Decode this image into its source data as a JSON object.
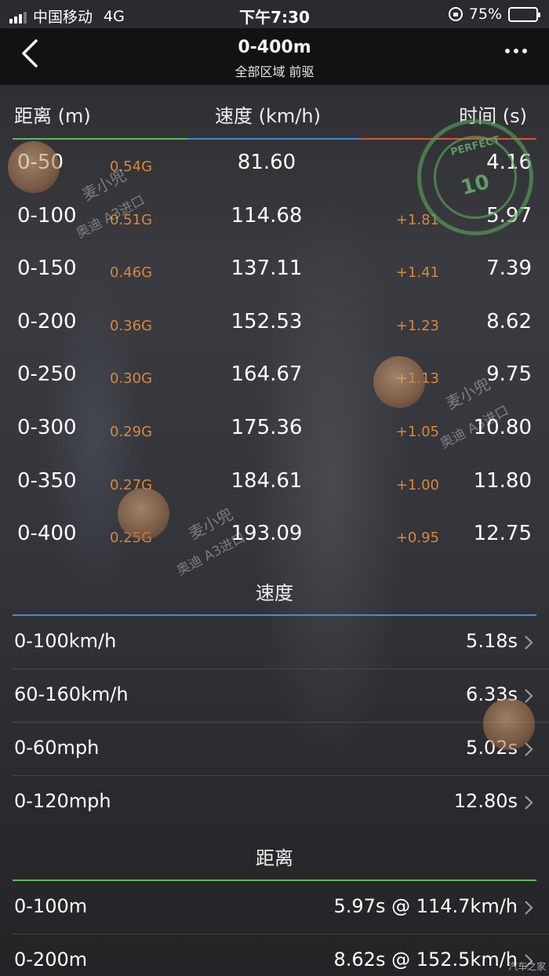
{
  "status_bar": {
    "carrier": "中国移动",
    "network": "4G",
    "time": "下午7:30",
    "battery_percent": "75%",
    "battery_level": 0.75
  },
  "nav": {
    "title": "0-400m",
    "subtitle": "全部区域 前驱"
  },
  "columns": {
    "distance": "距离 (m)",
    "speed": "速度 (km/h)",
    "time": "时间 (s)"
  },
  "rows": [
    {
      "dist": "0-50",
      "g": "0.54G",
      "speed": "81.60",
      "delta": "",
      "time": "4.16"
    },
    {
      "dist": "0-100",
      "g": "0.51G",
      "speed": "114.68",
      "delta": "+1.81",
      "time": "5.97"
    },
    {
      "dist": "0-150",
      "g": "0.46G",
      "speed": "137.11",
      "delta": "+1.41",
      "time": "7.39"
    },
    {
      "dist": "0-200",
      "g": "0.36G",
      "speed": "152.53",
      "delta": "+1.23",
      "time": "8.62"
    },
    {
      "dist": "0-250",
      "g": "0.30G",
      "speed": "164.67",
      "delta": "+1.13",
      "time": "9.75"
    },
    {
      "dist": "0-300",
      "g": "0.29G",
      "speed": "175.36",
      "delta": "+1.05",
      "time": "10.80"
    },
    {
      "dist": "0-350",
      "g": "0.27G",
      "speed": "184.61",
      "delta": "+1.00",
      "time": "11.80"
    },
    {
      "dist": "0-400",
      "g": "0.25G",
      "speed": "193.09",
      "delta": "+0.95",
      "time": "12.75"
    }
  ],
  "speed_section": {
    "title": "速度",
    "items": [
      {
        "label": "0-100km/h",
        "value": "5.18s"
      },
      {
        "label": "60-160km/h",
        "value": "6.33s"
      },
      {
        "label": "0-60mph",
        "value": "5.02s"
      },
      {
        "label": "0-120mph",
        "value": "12.80s"
      }
    ]
  },
  "distance_section": {
    "title": "距离",
    "items": [
      {
        "label": "0-100m",
        "value": "5.97s @ 114.7km/h"
      },
      {
        "label": "0-200m",
        "value": "8.62s @ 152.5km/h"
      }
    ]
  },
  "watermark": {
    "name": "麦小兜",
    "car": "奥迪 A3进口"
  },
  "stamp": {
    "text": "PERFECT",
    "score": "10"
  },
  "logo": "汽车之家",
  "colors": {
    "distance_line": "#5fb85a",
    "speed_line": "#4d86d6",
    "time_line": "#d8543c",
    "g_value": "#d8883a"
  }
}
